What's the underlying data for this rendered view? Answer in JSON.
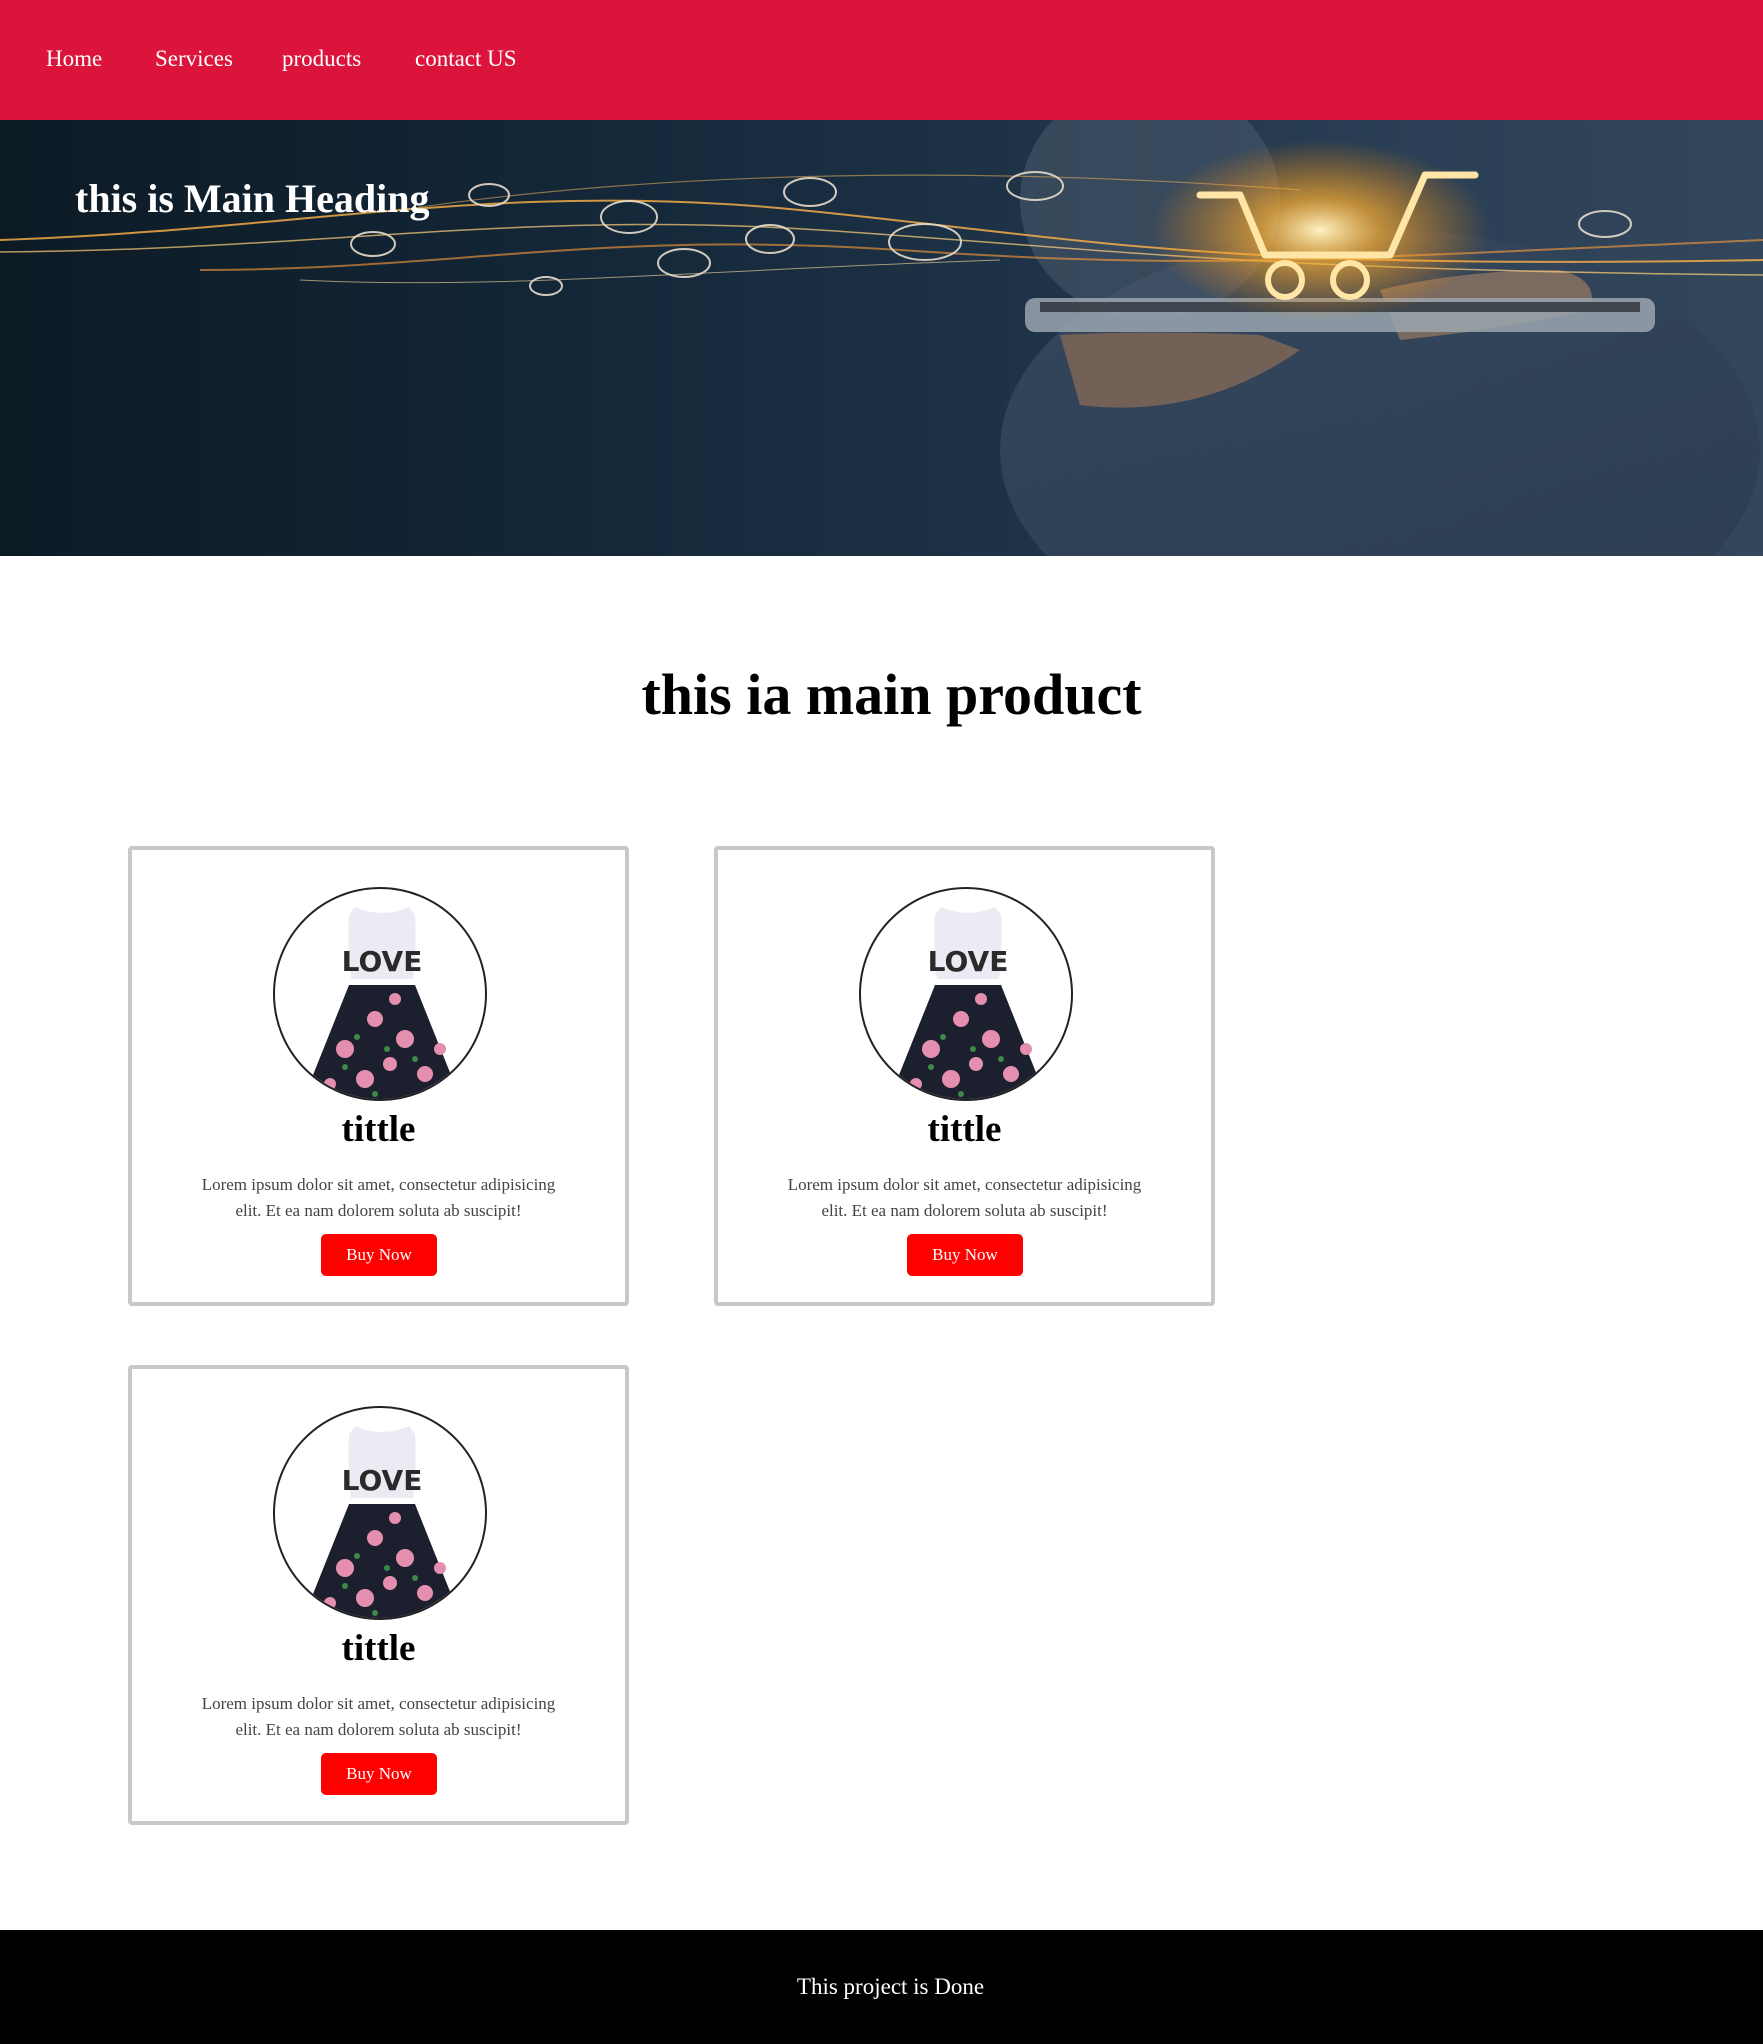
{
  "nav": {
    "items": [
      {
        "label": "Home"
      },
      {
        "label": "Services"
      },
      {
        "label": "products"
      },
      {
        "label": "contact US"
      }
    ],
    "background_color": "#dc143c"
  },
  "hero": {
    "title": "this is Main Heading",
    "image": "online-shopping-cart-banner"
  },
  "main": {
    "title": "this ia main product",
    "cards": [
      {
        "image": "girl-love-dress-image",
        "title": "tittle",
        "text": "Lorem ipsum dolor sit amet, consectetur adipisicing elit. Et ea nam dolorem soluta ab suscipit!",
        "button_label": "Buy Now"
      },
      {
        "image": "girl-love-dress-image",
        "title": "tittle",
        "text": "Lorem ipsum dolor sit amet, consectetur adipisicing elit. Et ea nam dolorem soluta ab suscipit!",
        "button_label": "Buy Now"
      },
      {
        "image": "girl-love-dress-image",
        "title": "tittle",
        "text": "Lorem ipsum dolor sit amet, consectetur adipisicing elit. Et ea nam dolorem soluta ab suscipit!",
        "button_label": "Buy Now"
      }
    ],
    "button_color": "#ff0000"
  },
  "footer": {
    "text": "This project is Done",
    "background_color": "#000000"
  }
}
